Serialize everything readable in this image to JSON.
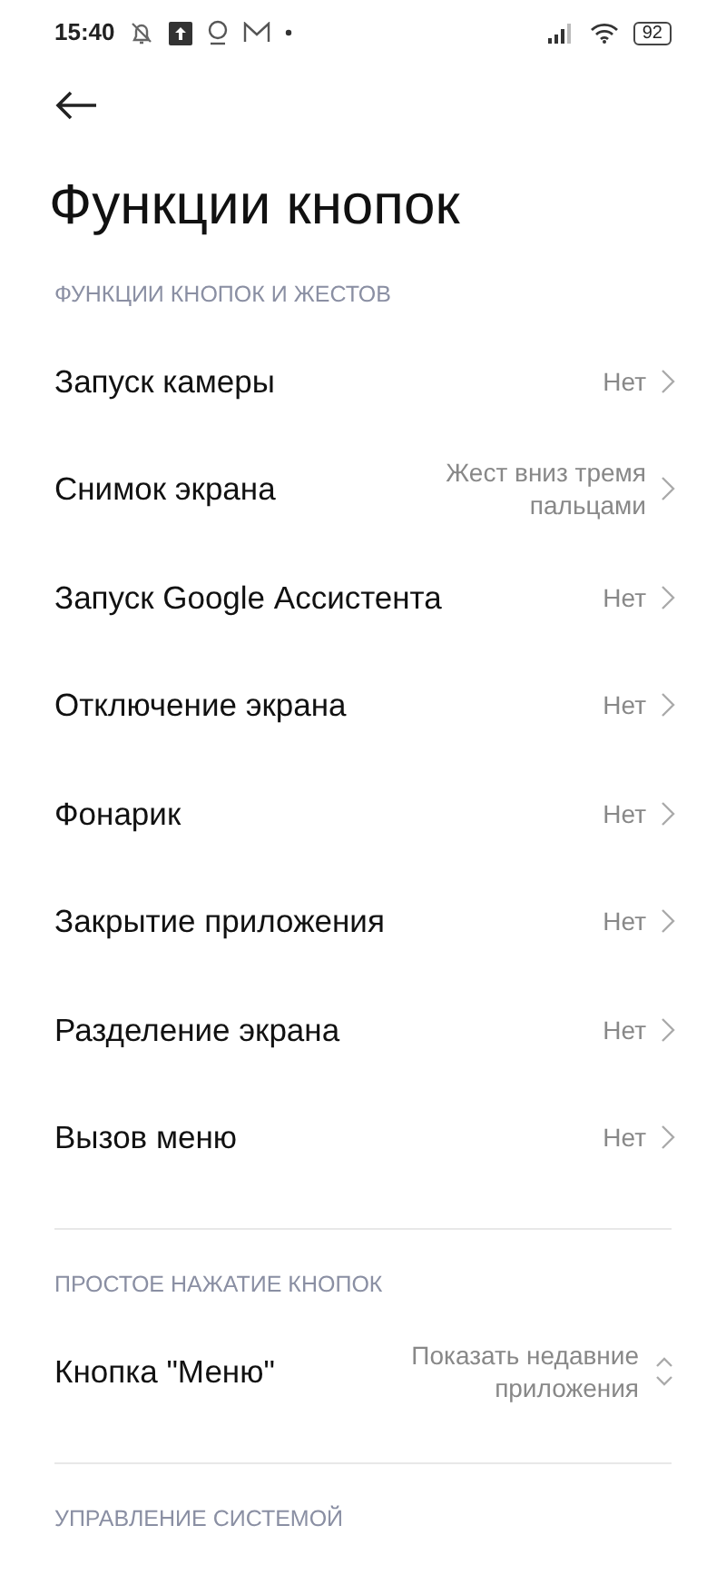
{
  "status_bar": {
    "time": "15:40",
    "battery": "92"
  },
  "title": "Функции кнопок",
  "sections": [
    {
      "header": "ФУНКЦИИ КНОПОК И ЖЕСТОВ",
      "items": [
        {
          "kind": "link",
          "label": "Запуск камеры",
          "value": "Нет"
        },
        {
          "kind": "link",
          "label": "Снимок экрана",
          "value": "Жест вниз тремя пальцами"
        },
        {
          "kind": "link",
          "label": "Запуск Google Ассистента",
          "value": "Нет"
        },
        {
          "kind": "link",
          "label": "Отключение экрана",
          "value": "Нет"
        },
        {
          "kind": "link",
          "label": "Фонарик",
          "value": "Нет"
        },
        {
          "kind": "link",
          "label": "Закрытие приложения",
          "value": "Нет"
        },
        {
          "kind": "link",
          "label": "Разделение экрана",
          "value": "Нет"
        },
        {
          "kind": "link",
          "label": "Вызов меню",
          "value": "Нет"
        }
      ]
    },
    {
      "header": "ПРОСТОЕ НАЖАТИЕ КНОПОК",
      "items": [
        {
          "kind": "dropdown",
          "label": "Кнопка \"Меню\"",
          "value": "Показать недавние приложения"
        }
      ]
    },
    {
      "header": "УПРАВЛЕНИЕ СИСТЕМОЙ"
    }
  ]
}
